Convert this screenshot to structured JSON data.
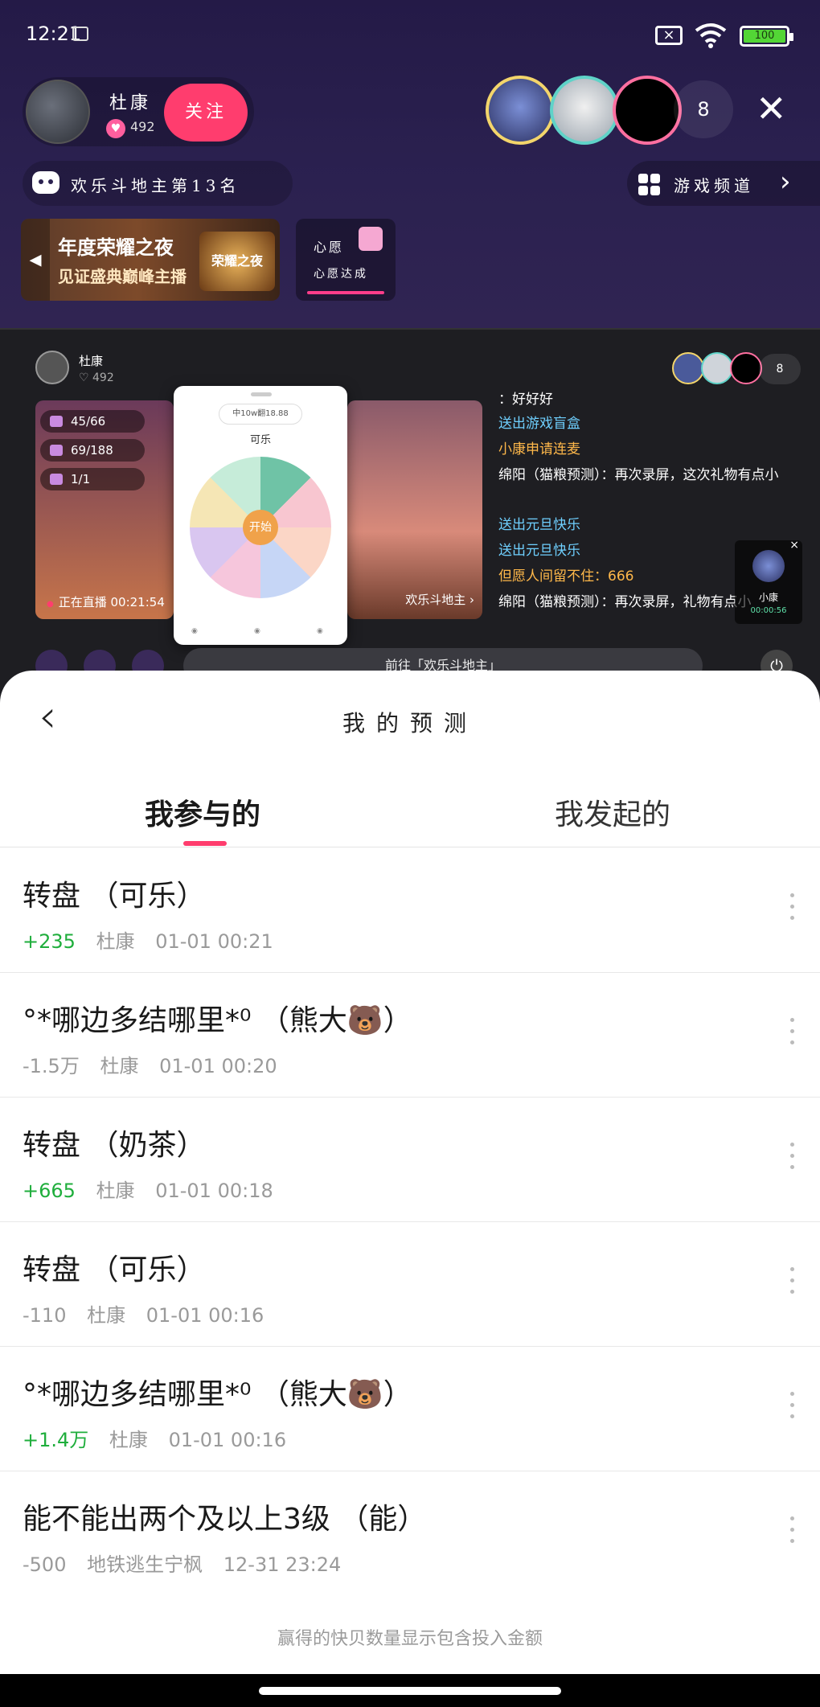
{
  "status_bar": {
    "time": "12:21",
    "battery": "100"
  },
  "room": {
    "host_name": "杜康",
    "host_likes": "492",
    "follow_label": "关注",
    "viewer_count": "8",
    "rank_text": "欢乐斗地主第13名",
    "channel_text": "游戏频道",
    "banner_line1": "年度荣耀之夜",
    "banner_line2": "见证盛典巅峰主播",
    "banner_badge": "荣耀之夜",
    "wish_title": "心愿",
    "wish_sub": "心愿达成"
  },
  "stream": {
    "host_name": "杜康",
    "host_likes": "♡ 492",
    "viewer_count": "8",
    "stats": [
      "45/66",
      "69/188",
      "1/1"
    ],
    "live_status": "正在直播 00:21:54",
    "wheel_prize": "中10w翻18.88",
    "wheel_title": "可乐",
    "wheel_start": "开始",
    "game_label": "欢乐斗地主 ›",
    "chat": [
      {
        "text": "：好好好",
        "style": "normal"
      },
      {
        "text": "送出游戏盲盒",
        "style": "sys"
      },
      {
        "text": "小康申请连麦",
        "style": "gold"
      },
      {
        "text": "绵阳（猫粮预测）：再次录屏，这次礼物有点小",
        "style": "normal"
      },
      {
        "text": "送出元旦快乐",
        "style": "sys"
      },
      {
        "text": "送出元旦快乐",
        "style": "sys"
      },
      {
        "text": "但愿人间留不住：666",
        "style": "gold"
      },
      {
        "text": "绵阳（猫粮预测）：再次录屏，礼物有点小",
        "style": "normal"
      }
    ],
    "mini_cam_name": "小康",
    "mini_cam_time": "00:00:56",
    "goto_label": "前往「欢乐斗地主」"
  },
  "sheet": {
    "title": "我的预测",
    "tabs": [
      "我参与的",
      "我发起的"
    ],
    "active_tab": 0,
    "items": [
      {
        "title": "转盘 （可乐）",
        "amount": "+235",
        "result": "win",
        "user": "杜康",
        "time": "01-01 00:21"
      },
      {
        "title": "°*哪边多结哪里*⁰ （熊大🐻）",
        "amount": "-1.5万",
        "result": "lose",
        "user": "杜康",
        "time": "01-01 00:20"
      },
      {
        "title": "转盘 （奶茶）",
        "amount": "+665",
        "result": "win",
        "user": "杜康",
        "time": "01-01 00:18"
      },
      {
        "title": "转盘 （可乐）",
        "amount": "-110",
        "result": "lose",
        "user": "杜康",
        "time": "01-01 00:16"
      },
      {
        "title": "°*哪边多结哪里*⁰ （熊大🐻）",
        "amount": "+1.4万",
        "result": "win",
        "user": "杜康",
        "time": "01-01 00:16"
      },
      {
        "title": "能不能出两个及以上3级 （能）",
        "amount": "-500",
        "result": "lose",
        "user": "地铁逃生宁枫",
        "time": "12-31 23:24"
      }
    ],
    "footer_note": "赢得的快贝数量显示包含投入金额"
  },
  "colors": {
    "accent": "#ff3d6e",
    "win": "#1fae3c",
    "neutral": "#9a9a9a"
  }
}
